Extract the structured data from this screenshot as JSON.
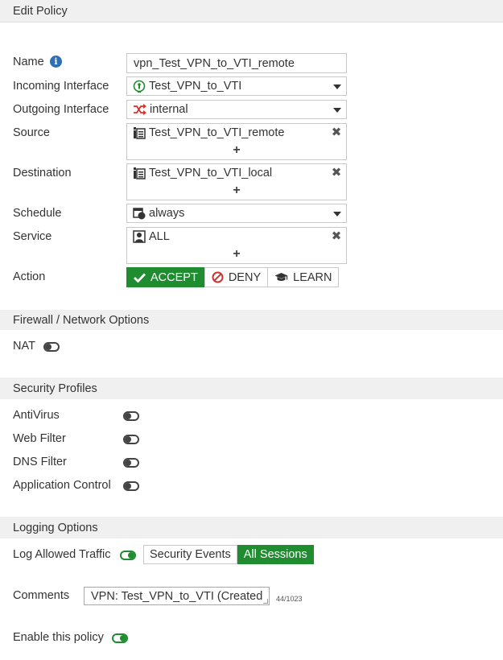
{
  "header": {
    "title": "Edit Policy"
  },
  "form": {
    "name": {
      "label": "Name",
      "value": "vpn_Test_VPN_to_VTI_remote"
    },
    "incoming": {
      "label": "Incoming Interface",
      "value": "Test_VPN_to_VTI"
    },
    "outgoing": {
      "label": "Outgoing Interface",
      "value": "internal"
    },
    "source": {
      "label": "Source",
      "value": "Test_VPN_to_VTI_remote"
    },
    "destination": {
      "label": "Destination",
      "value": "Test_VPN_to_VTI_local"
    },
    "schedule": {
      "label": "Schedule",
      "value": "always"
    },
    "service": {
      "label": "Service",
      "value": "ALL"
    },
    "action": {
      "label": "Action",
      "options": [
        "ACCEPT",
        "DENY",
        "LEARN"
      ],
      "selected": "ACCEPT"
    },
    "add_symbol": "+",
    "remove_symbol": "✖"
  },
  "firewall": {
    "title": "Firewall / Network Options",
    "nat": {
      "label": "NAT",
      "enabled": false
    }
  },
  "security": {
    "title": "Security Profiles",
    "items": [
      {
        "label": "AntiVirus",
        "enabled": false
      },
      {
        "label": "Web Filter",
        "enabled": false
      },
      {
        "label": "DNS Filter",
        "enabled": false
      },
      {
        "label": "Application Control",
        "enabled": false
      }
    ]
  },
  "logging": {
    "title": "Logging Options",
    "log_allowed": {
      "label": "Log Allowed Traffic",
      "enabled": true
    },
    "modes": [
      "Security Events",
      "All Sessions"
    ],
    "selected_mode": "All Sessions"
  },
  "comments": {
    "label": "Comments",
    "value": "VPN: Test_VPN_to_VTI (Created",
    "counter": "44/1023"
  },
  "enable": {
    "label": "Enable this policy",
    "enabled": true
  },
  "colors": {
    "accent": "#1f8c2f",
    "info": "#2f6fb5",
    "danger": "#d9302c"
  }
}
